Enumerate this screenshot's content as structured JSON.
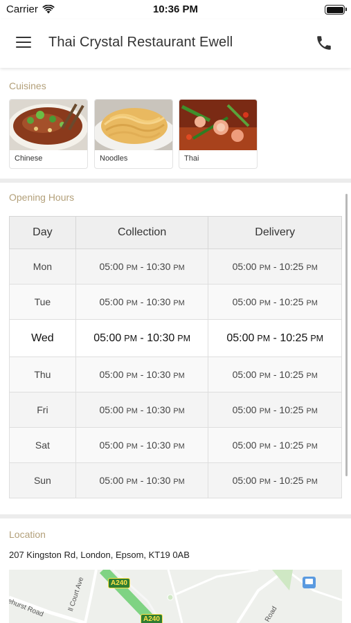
{
  "status_bar": {
    "carrier": "Carrier",
    "time": "10:36 PM"
  },
  "nav": {
    "title": "Thai Crystal Restaurant Ewell",
    "menu_icon": "hamburger-menu-icon",
    "phone_icon": "phone-icon"
  },
  "cuisines": {
    "title": "Cuisines",
    "items": [
      {
        "label": "Chinese"
      },
      {
        "label": "Noodles"
      },
      {
        "label": "Thai"
      }
    ]
  },
  "opening_hours": {
    "title": "Opening Hours",
    "headers": [
      "Day",
      "Collection",
      "Delivery"
    ],
    "pm_suffix": "PM",
    "rows": [
      {
        "day": "Mon",
        "collection_open": "05:00",
        "collection_close": "10:30",
        "delivery_open": "05:00",
        "delivery_close": "10:25"
      },
      {
        "day": "Tue",
        "collection_open": "05:00",
        "collection_close": "10:30",
        "delivery_open": "05:00",
        "delivery_close": "10:25"
      },
      {
        "day": "Wed",
        "collection_open": "05:00",
        "collection_close": "10:30",
        "delivery_open": "05:00",
        "delivery_close": "10:25",
        "today": true
      },
      {
        "day": "Thu",
        "collection_open": "05:00",
        "collection_close": "10:30",
        "delivery_open": "05:00",
        "delivery_close": "10:25"
      },
      {
        "day": "Fri",
        "collection_open": "05:00",
        "collection_close": "10:30",
        "delivery_open": "05:00",
        "delivery_close": "10:25"
      },
      {
        "day": "Sat",
        "collection_open": "05:00",
        "collection_close": "10:30",
        "delivery_open": "05:00",
        "delivery_close": "10:25"
      },
      {
        "day": "Sun",
        "collection_open": "05:00",
        "collection_close": "10:30",
        "delivery_open": "05:00",
        "delivery_close": "10:25"
      }
    ]
  },
  "location": {
    "title": "Location",
    "address": "207 Kingston Rd, London, Epsom, KT19 0AB",
    "map": {
      "road_badge_1": "A240",
      "road_badge_2": "A240",
      "street_1": "kehurst Road",
      "street_2": "ll Court Ave",
      "street_3": "Road"
    }
  },
  "colors": {
    "section_title": "#b3a07a",
    "road_green": "#79d37b",
    "badge_green": "#2e7d32"
  }
}
